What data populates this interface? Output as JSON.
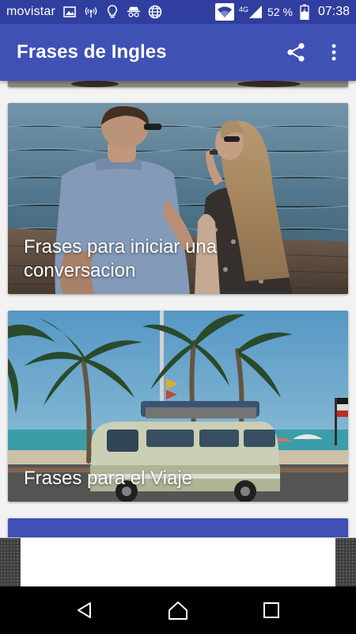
{
  "status_bar": {
    "carrier": "movistar",
    "network_type": "4G",
    "battery_percent": "52 %",
    "time": "07:38",
    "icons": [
      "image-icon",
      "hotspot-icon",
      "lightbulb-icon",
      "incognito-icon",
      "globe-icon",
      "wifi-icon",
      "signal-icon",
      "battery-charging-icon"
    ]
  },
  "toolbar": {
    "title": "Frases de Ingles",
    "share_icon": "share-icon",
    "more_icon": "more-vert-icon"
  },
  "cards": [
    {
      "caption": "Frases para iniciar una conversacion",
      "image": "couple-by-sea-photo"
    },
    {
      "caption": "Frases para el Viaje",
      "image": "van-under-palm-trees-photo"
    }
  ],
  "nav_bar": {
    "back_icon": "back-icon",
    "home_icon": "home-icon",
    "recents_icon": "recents-icon"
  },
  "colors": {
    "status_bar": "#303f9f",
    "toolbar": "#3f51b5",
    "background": "#f2f2f2"
  }
}
